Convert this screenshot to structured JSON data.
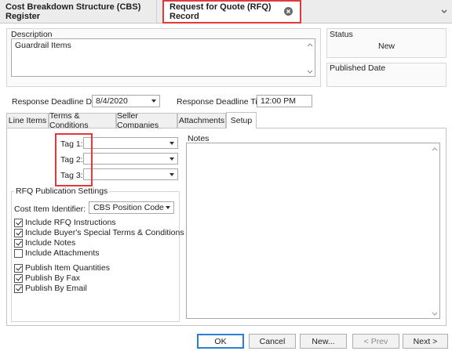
{
  "doc_tabs": {
    "register": "Cost Breakdown Structure (CBS) Register",
    "rfq_record": "Request for Quote (RFQ) Record"
  },
  "description": {
    "label": "Description",
    "value": "Guardrail Items"
  },
  "status": {
    "label": "Status",
    "value": "New"
  },
  "published_date": {
    "label": "Published Date",
    "value": ""
  },
  "response_deadline": {
    "date_label": "Response Deadline Date:",
    "date_value": "8/4/2020",
    "time_label": "Response Deadline Time:",
    "time_value": "12:00 PM"
  },
  "tabs": [
    "Line Items",
    "Terms & Conditions",
    "Seller Companies",
    "Attachments",
    "Setup"
  ],
  "active_tab": "Setup",
  "tags": [
    {
      "label": "Tag 1:",
      "value": ""
    },
    {
      "label": "Tag 2:",
      "value": ""
    },
    {
      "label": "Tag 3:",
      "value": ""
    }
  ],
  "notes": {
    "label": "Notes",
    "value": ""
  },
  "publication_settings": {
    "title": "RFQ Publication Settings",
    "cost_item_label": "Cost Item Identifier:",
    "cost_item_value": "CBS Position Code",
    "checkboxes": [
      {
        "label": "Include RFQ Instructions",
        "checked": true
      },
      {
        "label": "Include Buyer's Special Terms & Conditions",
        "checked": true
      },
      {
        "label": "Include Notes",
        "checked": true
      },
      {
        "label": "Include Attachments",
        "checked": false
      },
      {
        "label": "Publish Item Quantities",
        "checked": true
      },
      {
        "label": "Publish By Fax",
        "checked": true
      },
      {
        "label": "Publish By Email",
        "checked": true
      }
    ]
  },
  "buttons": {
    "ok": "OK",
    "cancel": "Cancel",
    "new": "New...",
    "prev": "< Prev",
    "next": "Next >"
  },
  "icons": {
    "close": "close-circle-icon",
    "dropdown": "chevron-down-icon",
    "scroll_up": "scroll-up-icon",
    "scroll_down": "scroll-down-icon"
  },
  "colors": {
    "highlight": "#e23a3a",
    "primary_button_border": "#2a7fd4",
    "tab_bar": "#f0f0f0"
  }
}
